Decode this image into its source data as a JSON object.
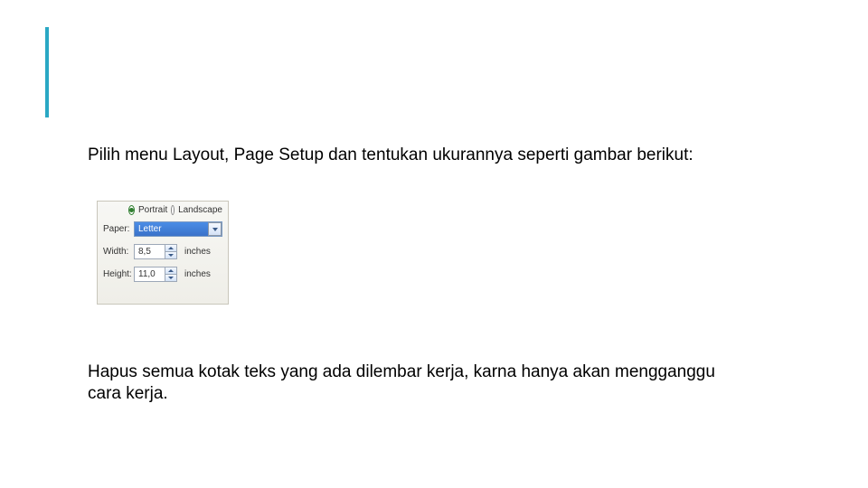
{
  "accent_color": "#2aa8c4",
  "paragraphs": {
    "top": "Pilih menu Layout, Page Setup dan tentukan ukurannya seperti gambar berikut:",
    "bottom": "Hapus semua kotak teks yang ada dilembar kerja, karna hanya akan mengganggu cara kerja."
  },
  "dialog": {
    "orientation": {
      "portrait_label": "Portrait",
      "landscape_label": "Landscape",
      "selected": "portrait"
    },
    "paper": {
      "label": "Paper:",
      "value": "Letter"
    },
    "width": {
      "label": "Width:",
      "value": "8,5",
      "unit": "inches"
    },
    "height": {
      "label": "Height:",
      "value": "11,0",
      "unit": "inches"
    }
  }
}
